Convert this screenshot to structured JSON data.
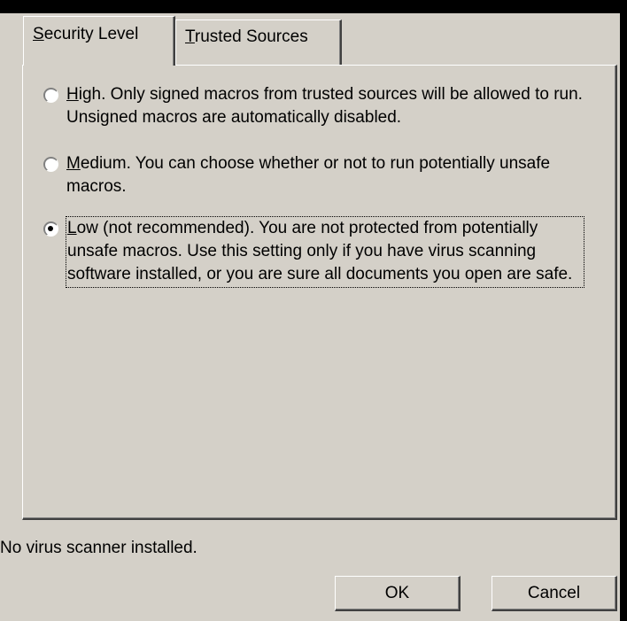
{
  "tabs": [
    {
      "label_first": "S",
      "label_rest": "ecurity Level",
      "active": true
    },
    {
      "label_first": "T",
      "label_rest": "rusted Sources",
      "active": false
    }
  ],
  "options": {
    "high": {
      "accel": "H",
      "rest": "igh. Only signed macros from trusted sources will be allowed to run. Unsigned macros are automatically disabled.",
      "checked": false
    },
    "medium": {
      "accel": "M",
      "rest": "edium. You can choose whether or not to run potentially unsafe macros.",
      "checked": false
    },
    "low": {
      "accel": "L",
      "rest": "ow (not recommended). You are not protected from potentially unsafe macros. Use this setting only if you have virus scanning software installed, or you are sure all documents you open are safe.",
      "checked": true
    }
  },
  "status_text": "No virus scanner installed.",
  "buttons": {
    "ok": "OK",
    "cancel": "Cancel"
  },
  "colors": {
    "face": "#d4d0c8",
    "background": "#000000"
  }
}
